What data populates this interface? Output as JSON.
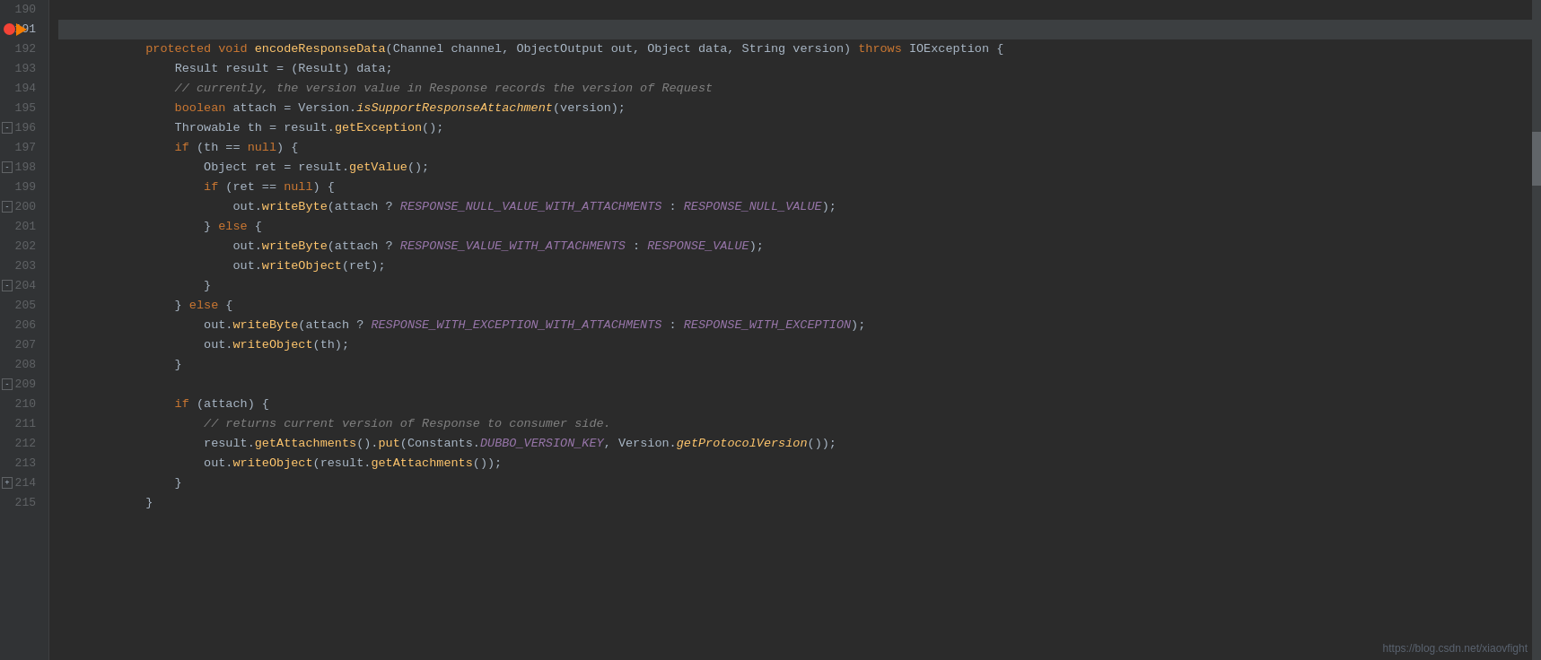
{
  "editor": {
    "background": "#2b2b2b",
    "watermark": "https://blog.csdn.net/xiaovfight"
  },
  "lines": [
    {
      "num": 190,
      "indent": 1,
      "hasAnnotation": true
    },
    {
      "num": 191,
      "indent": 1,
      "hasCurrent": true,
      "hasBreakpoint": true,
      "hasFold": true
    },
    {
      "num": 192,
      "indent": 2
    },
    {
      "num": 193,
      "indent": 2
    },
    {
      "num": 194,
      "indent": 2
    },
    {
      "num": 195,
      "indent": 2
    },
    {
      "num": 196,
      "indent": 2
    },
    {
      "num": 197,
      "indent": 3
    },
    {
      "num": 198,
      "indent": 3
    },
    {
      "num": 199,
      "indent": 4
    },
    {
      "num": 200,
      "indent": 3,
      "hasFold2": true
    },
    {
      "num": 201,
      "indent": 4
    },
    {
      "num": 202,
      "indent": 4
    },
    {
      "num": 203,
      "indent": 3
    },
    {
      "num": 204,
      "indent": 2,
      "hasFold3": true
    },
    {
      "num": 205,
      "indent": 3
    },
    {
      "num": 206,
      "indent": 3
    },
    {
      "num": 207,
      "indent": 2
    },
    {
      "num": 208,
      "indent": 0
    },
    {
      "num": 209,
      "indent": 2
    },
    {
      "num": 210,
      "indent": 3
    },
    {
      "num": 211,
      "indent": 3
    },
    {
      "num": 212,
      "indent": 3
    },
    {
      "num": 213,
      "indent": 2
    },
    {
      "num": 214,
      "indent": 1,
      "hasFold4": true
    },
    {
      "num": 215,
      "indent": 0
    }
  ]
}
